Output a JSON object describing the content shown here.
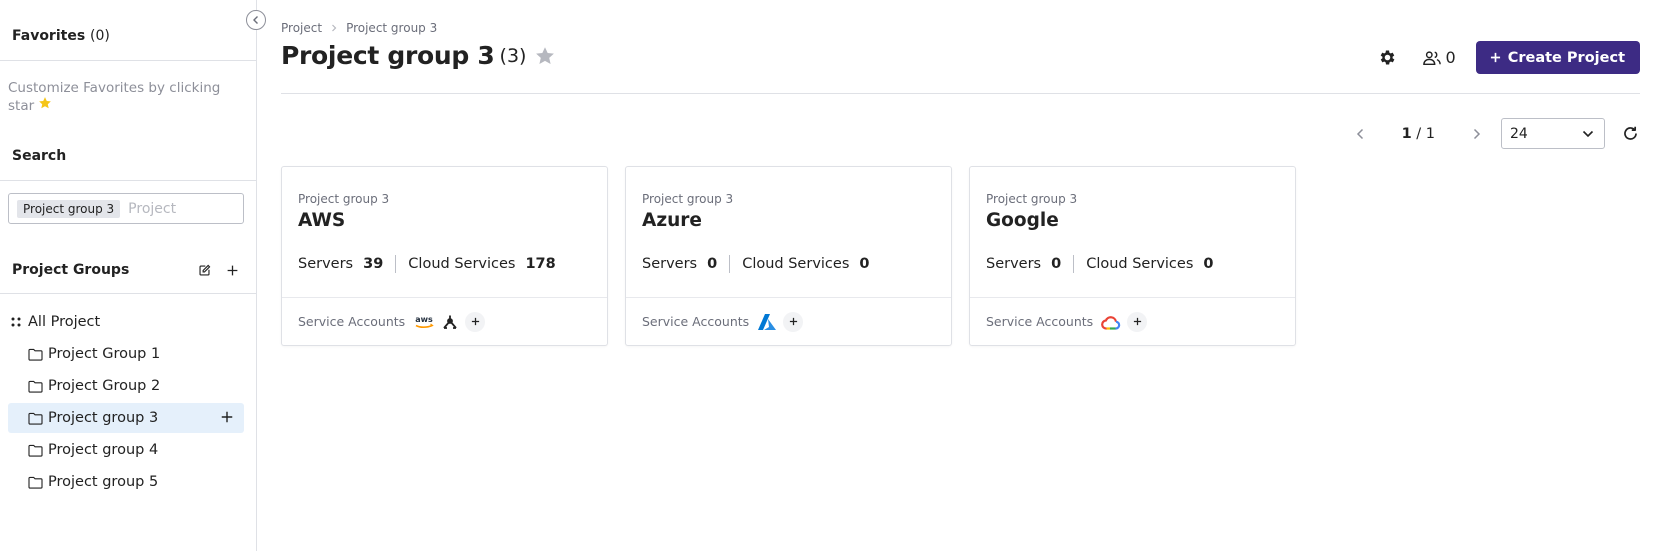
{
  "sidebar": {
    "favorites": {
      "title": "Favorites",
      "count": "(0)",
      "hint": "Customize Favorites by clicking star",
      "hint_icon": "star-emoji-icon"
    },
    "search": {
      "title": "Search",
      "tag": "Project group 3",
      "placeholder": "Project",
      "value": ""
    },
    "project_groups": {
      "title": "Project Groups",
      "all_label": "All Project",
      "items": [
        {
          "label": "Project Group 1"
        },
        {
          "label": "Project Group 2"
        },
        {
          "label": "Project group 3"
        },
        {
          "label": "Project group 4"
        },
        {
          "label": "Project group 5"
        }
      ],
      "selected": "Project group 3"
    }
  },
  "header": {
    "breadcrumb": [
      "Project",
      "Project group 3"
    ],
    "title": "Project group 3",
    "count": "(3)",
    "members_count": "0",
    "create_label": "Create Project"
  },
  "pagination": {
    "current": "1",
    "total": "/ 1",
    "page_size": "24"
  },
  "cards": [
    {
      "group": "Project group 3",
      "name": "AWS",
      "servers_label": "Servers",
      "servers": "39",
      "cloud_label": "Cloud Services",
      "cloud": "178",
      "sa_label": "Service Accounts",
      "sa_icons": [
        "aws-logo-icon",
        "alibaba-tripod-icon"
      ]
    },
    {
      "group": "Project group 3",
      "name": "Azure",
      "servers_label": "Servers",
      "servers": "0",
      "cloud_label": "Cloud Services",
      "cloud": "0",
      "sa_label": "Service Accounts",
      "sa_icons": [
        "azure-logo-icon"
      ]
    },
    {
      "group": "Project group 3",
      "name": "Google",
      "servers_label": "Servers",
      "servers": "0",
      "cloud_label": "Cloud Services",
      "cloud": "0",
      "sa_label": "Service Accounts",
      "sa_icons": [
        "google-cloud-logo-icon"
      ]
    }
  ],
  "colors": {
    "primary_button": "#3d2b84",
    "selected_row": "#e5f0fb",
    "muted_text": "#6b6e7a",
    "favorite_star": "#f5c518"
  }
}
